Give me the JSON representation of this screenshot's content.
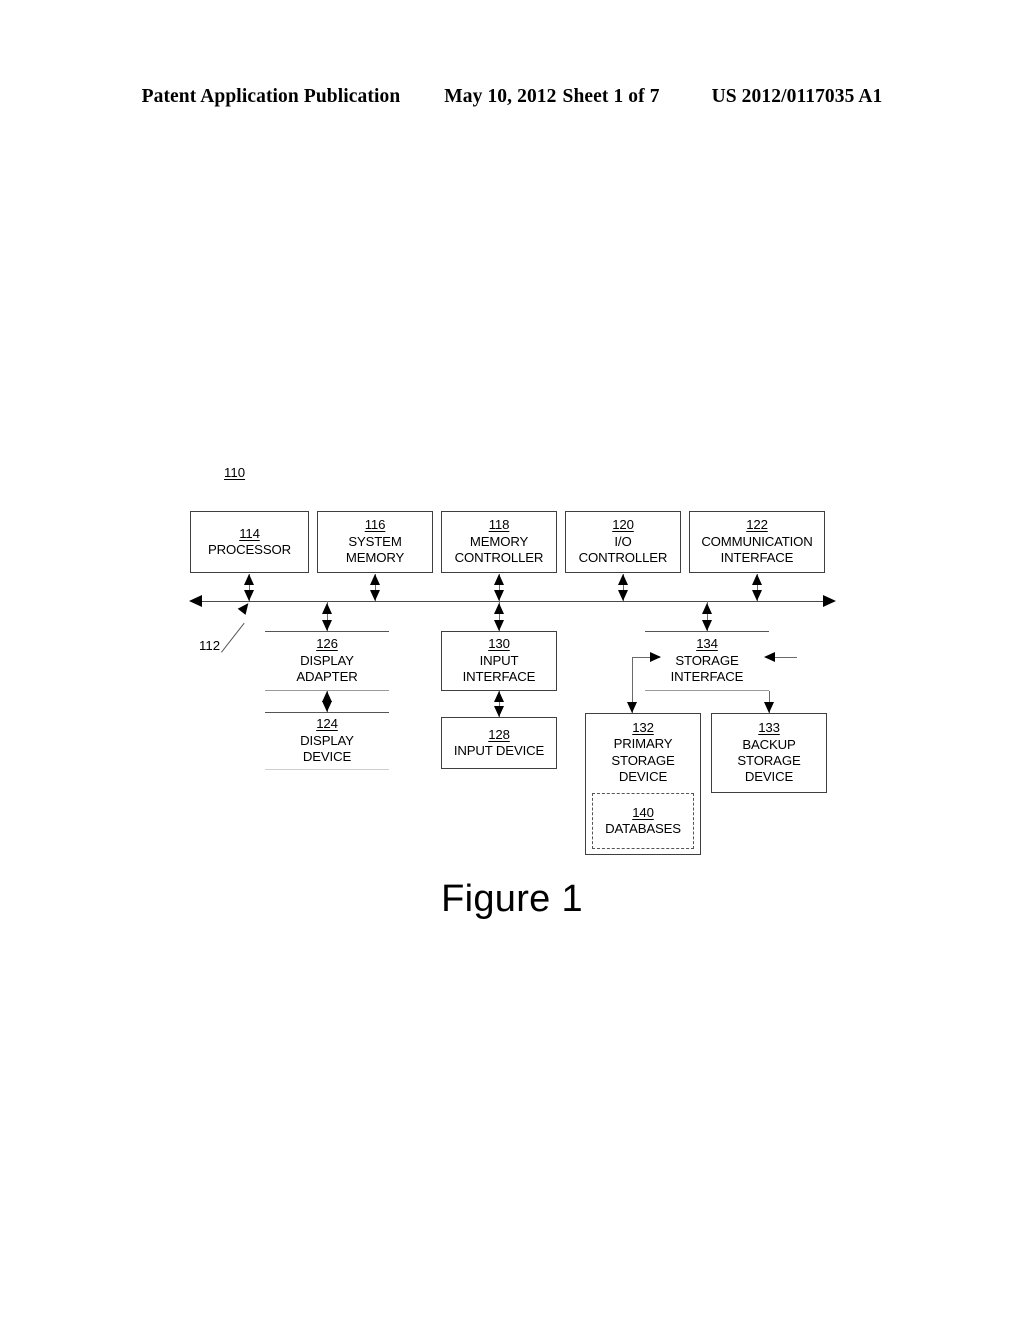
{
  "header": {
    "publication": "Patent Application Publication",
    "date": "May 10, 2012",
    "sheet": "Sheet 1 of 7",
    "patent_number": "US 2012/0117035 A1"
  },
  "figure": {
    "caption": "Figure 1",
    "system_ref": "110",
    "bus_ref": "112"
  },
  "nodes": {
    "processor": {
      "ref": "114",
      "line1": "PROCESSOR",
      "line2": "",
      "line3": ""
    },
    "system_memory": {
      "ref": "116",
      "line1": "SYSTEM",
      "line2": "MEMORY",
      "line3": ""
    },
    "memory_controller": {
      "ref": "118",
      "line1": "MEMORY",
      "line2": "CONTROLLER",
      "line3": ""
    },
    "io_controller": {
      "ref": "120",
      "line1": "I/O",
      "line2": "CONTROLLER",
      "line3": ""
    },
    "communication_interface": {
      "ref": "122",
      "line1": "COMMUNICATION",
      "line2": "INTERFACE",
      "line3": ""
    },
    "display_adapter": {
      "ref": "126",
      "line1": "DISPLAY",
      "line2": "ADAPTER",
      "line3": ""
    },
    "input_interface": {
      "ref": "130",
      "line1": "INPUT",
      "line2": "INTERFACE",
      "line3": ""
    },
    "storage_interface": {
      "ref": "134",
      "line1": "STORAGE",
      "line2": "INTERFACE",
      "line3": ""
    },
    "display_device": {
      "ref": "124",
      "line1": "DISPLAY",
      "line2": "DEVICE",
      "line3": ""
    },
    "input_device": {
      "ref": "128",
      "line1": "INPUT DEVICE",
      "line2": "",
      "line3": ""
    },
    "primary_storage_device": {
      "ref": "132",
      "line1": "PRIMARY",
      "line2": "STORAGE",
      "line3": "DEVICE"
    },
    "backup_storage_device": {
      "ref": "133",
      "line1": "BACKUP",
      "line2": "STORAGE",
      "line3": "DEVICE"
    },
    "databases": {
      "ref": "140",
      "line1": "DATABASES",
      "line2": "",
      "line3": ""
    }
  },
  "colors": {
    "ink": "#000000",
    "line": "#4a4a4a",
    "faint_line": "#9a9a9a",
    "background": "#ffffff"
  }
}
